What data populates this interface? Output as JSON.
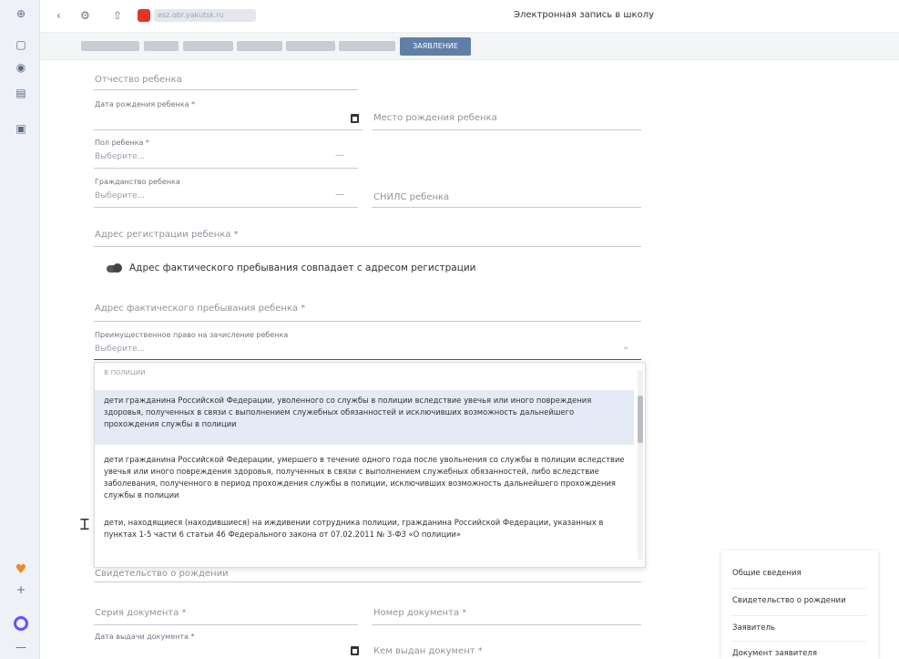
{
  "browser": {
    "url": "esz.obr.yakutsk.ru",
    "page_title": "Электронная запись в школу"
  },
  "nav": {
    "active_tab": "ЗАЯВЛЕНИЕ"
  },
  "form": {
    "patronymic_placeholder": "Отчество ребенка",
    "birth_date_label": "Дата рождения ребенка *",
    "birth_place_placeholder": "Место рождения ребенка",
    "gender_label": "Пол ребенка *",
    "gender_placeholder": "Выберите...",
    "citizenship_label": "Гражданство ребенка",
    "citizenship_placeholder": "Выберите...",
    "snils_placeholder": "СНИЛС ребенка",
    "registration_address_placeholder": "Адрес регистрации ребенка *",
    "toggle_label": "Адрес фактического пребывания совпадает с адресом регистрации",
    "actual_address_placeholder": "Адрес фактического пребывания ребенка *",
    "privilege_label": "Преимущественное право на зачисление ребенка",
    "privilege_placeholder": "Выберите...",
    "birth_cert_placeholder": "Свидетельство о рождении",
    "doc_series_placeholder": "Серия документа *",
    "doc_number_placeholder": "Номер документа *",
    "issue_date_label": "Дата выдачи документа *",
    "issued_by_placeholder": "Кем выдан документ *"
  },
  "dropdown": {
    "cut_top": "в полиции",
    "options": [
      "дети гражданина Российской Федерации, уволенного со службы в полиции вследствие увечья или иного повреждения здоровья, полученных в связи с выполнением служебных обязанностей и исключивших возможность дальнейшего прохождения службы в полиции",
      "дети гражданина Российской Федерации, умершего в течение одного года после увольнения со службы в полиции вследствие увечья или иного повреждения здоровья, полученных в связи с выполнением служебных обязанностей, либо вследствие заболевания, полученного в период прохождения службы в полиции, исключивших возможность дальнейшего прохождения службы в полиции",
      "дети, находящиеся (находившиеся) на иждивении сотрудника полиции, гражданина Российской Федерации, указанных в пунктах 1-5 части 6 статьи 46 Федерального закона от 07.02.2011 № 3-ФЗ «О полиции»"
    ]
  },
  "side_menu": {
    "items": [
      "Общие сведения",
      "Свидетельство о рождении",
      "Заявитель",
      "Документ заявителя"
    ]
  }
}
